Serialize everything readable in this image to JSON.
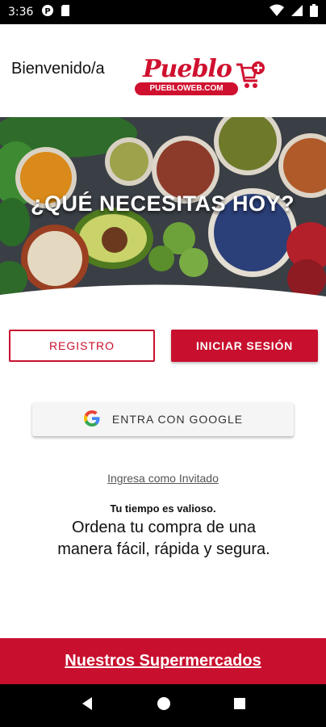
{
  "status_bar": {
    "time": "3:36",
    "icons_left": [
      "pueblo-app-icon",
      "sd-card-icon"
    ],
    "icons_right": [
      "wifi-icon",
      "signal-icon",
      "battery-icon"
    ]
  },
  "header": {
    "welcome_text": "Bienvenido/a",
    "logo_word": "Pueblo",
    "logo_sub": "PUEBLOWEB.COM"
  },
  "hero": {
    "title": "¿QUÉ NECESITAS HOY?"
  },
  "buttons": {
    "registro": "REGISTRO",
    "login": "INICIAR SESIÓN",
    "google": "ENTRA CON GOOGLE"
  },
  "guest_link": "Ingresa como Invitado",
  "tagline": {
    "small": "Tu tiempo es valioso.",
    "big": "Ordena tu compra de una manera fácil, rápida y segura."
  },
  "footer": {
    "link": "Nuestros Supermercados"
  },
  "nav": {
    "icons": [
      "back-icon",
      "home-icon",
      "recents-icon"
    ]
  },
  "colors": {
    "brand_red": "#c8102e",
    "logo_red": "#d0102f"
  }
}
